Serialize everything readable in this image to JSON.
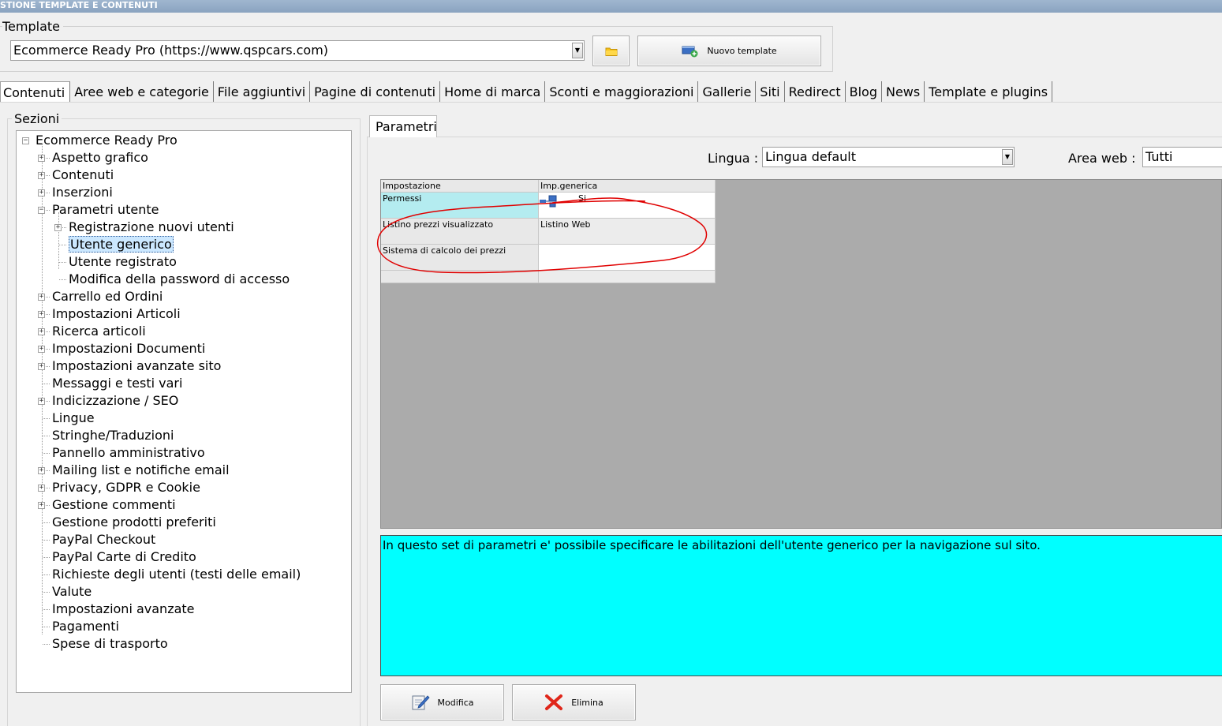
{
  "window": {
    "title": "STIONE TEMPLATE E CONTENUTI"
  },
  "template": {
    "label": "Template",
    "selected": "Ecommerce Ready Pro (https://www.qspcars.com)",
    "new_button": "Nuovo template"
  },
  "tabs": [
    "Contenuti",
    "Aree web e categorie",
    "File aggiuntivi",
    "Pagine di contenuti",
    "Home di marca",
    "Sconti e maggiorazioni",
    "Gallerie",
    "Siti",
    "Redirect",
    "Blog",
    "News",
    "Template e plugins"
  ],
  "sezioni": {
    "label": "Sezioni",
    "root": "Ecommerce Ready Pro",
    "items": [
      {
        "label": "Aspetto grafico",
        "expander": "+"
      },
      {
        "label": "Contenuti",
        "expander": "+"
      },
      {
        "label": "Inserzioni",
        "expander": "+"
      },
      {
        "label": "Parametri utente",
        "expander": "−"
      },
      {
        "label": "Registrazione nuovi utenti",
        "expander": "+"
      },
      {
        "label": "Utente generico",
        "selected": true
      },
      {
        "label": "Utente registrato"
      },
      {
        "label": "Modifica della password di accesso"
      },
      {
        "label": "Carrello ed Ordini",
        "expander": "+"
      },
      {
        "label": "Impostazioni Articoli",
        "expander": "+"
      },
      {
        "label": "Ricerca articoli",
        "expander": "+"
      },
      {
        "label": "Impostazioni Documenti",
        "expander": "+"
      },
      {
        "label": "Impostazioni avanzate sito",
        "expander": "+"
      },
      {
        "label": "Messaggi e testi vari"
      },
      {
        "label": "Indicizzazione / SEO",
        "expander": "+"
      },
      {
        "label": "Lingue"
      },
      {
        "label": "Stringhe/Traduzioni"
      },
      {
        "label": "Pannello amministrativo"
      },
      {
        "label": "Mailing list e notifiche email",
        "expander": "+"
      },
      {
        "label": "Privacy, GDPR e Cookie",
        "expander": "+"
      },
      {
        "label": "Gestione commenti",
        "expander": "+"
      },
      {
        "label": "Gestione prodotti preferiti"
      },
      {
        "label": "PayPal Checkout"
      },
      {
        "label": "PayPal Carte di Credito"
      },
      {
        "label": "Richieste degli utenti (testi delle email)"
      },
      {
        "label": "Valute"
      },
      {
        "label": "Impostazioni avanzate"
      },
      {
        "label": "Pagamenti"
      },
      {
        "label": "Spese di trasporto"
      }
    ]
  },
  "parametri": {
    "tab_label": "Parametri",
    "lingua_label": "Lingua :",
    "lingua_value": "Lingua default",
    "area_label": "Area web :",
    "area_value": "Tutti",
    "grid": {
      "headers": [
        "Impostazione",
        "Imp.generica"
      ],
      "rows": [
        {
          "setting": "Permessi",
          "value": "Si"
        },
        {
          "setting": "Listino prezzi visualizzato",
          "value": "Listino Web"
        },
        {
          "setting": "Sistema di calcolo dei prezzi",
          "value": ""
        }
      ]
    },
    "description": "In questo set di parametri e' possibile specificare le abilitazioni dell'utente generico per la navigazione sul sito.",
    "buttons": {
      "modifica": "Modifica",
      "elimina": "Elimina"
    }
  },
  "colors": {
    "description_bg": "#00ffff",
    "selected_row_bg": "#b4ecf0",
    "annotation": "#e00000"
  }
}
